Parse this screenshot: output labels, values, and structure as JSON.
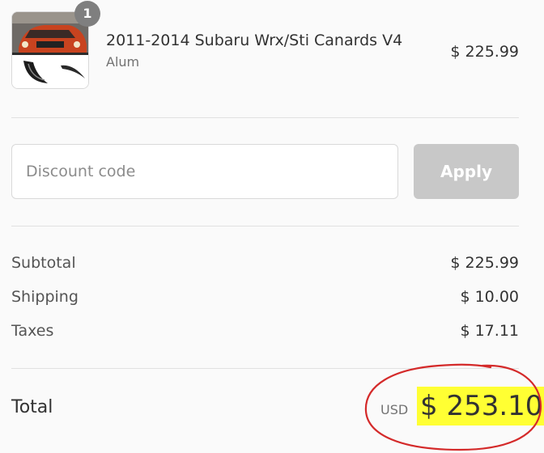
{
  "product": {
    "quantity": "1",
    "title": "2011-2014 Subaru Wrx/Sti Canards V4",
    "variant": "Alum",
    "price": "$ 225.99",
    "thumbnail_icon": "car-canard-product-image"
  },
  "discount": {
    "placeholder": "Discount code",
    "value": "",
    "apply_label": "Apply"
  },
  "summary": {
    "subtotal_label": "Subtotal",
    "subtotal_value": "$ 225.99",
    "shipping_label": "Shipping",
    "shipping_value": "$ 10.00",
    "taxes_label": "Taxes",
    "taxes_value": "$ 17.11"
  },
  "total": {
    "label": "Total",
    "currency": "USD",
    "amount": "$ 253.10"
  },
  "colors": {
    "highlight": "#ffff33",
    "annotation": "#d42a2a",
    "apply_disabled": "#c8c8c8",
    "badge": "#7f7f7f"
  }
}
